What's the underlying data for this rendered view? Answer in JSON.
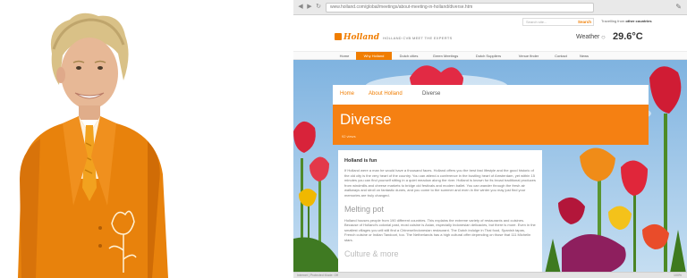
{
  "browser": {
    "url": "www.holland.com/global/meetings/about-meeting-in-holland/diverse.htm",
    "back_icon": "back-arrow-icon",
    "forward_icon": "forward-arrow-icon",
    "reload_icon": "reload-icon",
    "menu_icon": "wrench-icon"
  },
  "header": {
    "search_placeholder": "Search site...",
    "search_button": "Search",
    "country_text": "Travelling from ",
    "country_name": "other countries",
    "logo_text": "Holland",
    "tagline": "HOLLAND CVB MEET THE EXPERTS",
    "weather_label": "Weather",
    "weather_icon": "cloud-icon",
    "weather_temp": "29.6°C"
  },
  "nav": {
    "items": [
      "Home",
      "Why Holland",
      "Dutch cities",
      "Green Meetings",
      "Dutch Suppliers",
      "Venue finder",
      "Contact",
      "News"
    ],
    "active_index": 1
  },
  "breadcrumb": {
    "home": "Home",
    "parent": "About Holland",
    "current": "Diverse"
  },
  "page": {
    "title": "Diverse",
    "meta": "92 views"
  },
  "article": {
    "subheading": "Holland is fun",
    "paragraph1": "If Holland were a man he would have a thousand faces. Holland offers you the best fast lifestyle and the good historic of the old city is the very heart of the country. You can attend a conference in the bustling heart of Amsterdam, yet within 15 minutes you can find yourself sitting in a quiet meadow along the river. Holland is known for its broad traditional produces from windmills and cheese markets to bridge old festivals and modern ballet. You can wander through the fresh air walkways and stroll on fantastic dunes, and you come to the summer and even in the winter you may just find your memories are truly changed.",
    "heading2": "Melting pot",
    "paragraph2": "Holland houses people from 190 different countries. This explains the extreme variety of restaurants and cuisines. Because of Holland's colonial past, most cuisine is Asian, especially Indonesian delicacies, but there is more. Even in the smallest villages you will still find a Chinese/Indonesian restaurant. The Dutch indulge in Thai food, Spanish tapas, French cuisine or Indian Tandoori, too. The Netherlands has a high cultural offer depending on those that 111 Michelin stars.",
    "heading3": "Culture & more"
  },
  "status": {
    "left": "Internet | Protected Mode: Off",
    "right": "100%"
  },
  "photo": {
    "subject": "man-in-orange-suit"
  },
  "colors": {
    "brand_orange": "#f58012",
    "nav_active": "#f07d00",
    "suit_orange": "#e8820c",
    "sky": "#6fa7d6"
  }
}
